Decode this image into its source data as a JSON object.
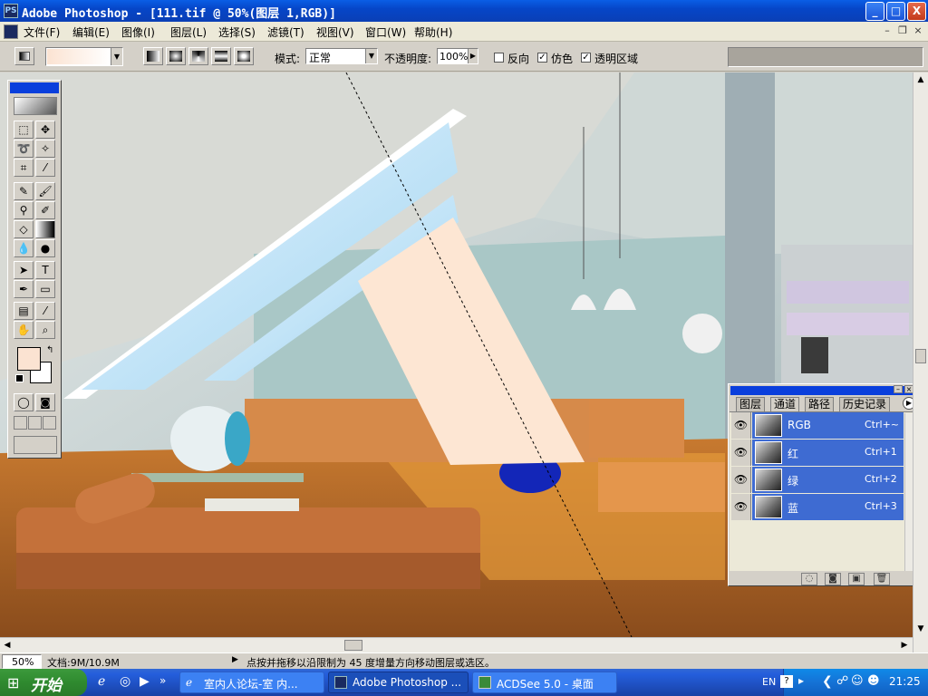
{
  "window": {
    "title": "Adobe Photoshop - [111.tif @ 50%(图层 1,RGB)]",
    "app_icon": "PS",
    "minimize": "_",
    "maximize": "□",
    "close": "X"
  },
  "menu": {
    "items": [
      "文件(F)",
      "编辑(E)",
      "图像(I)",
      "图层(L)",
      "选择(S)",
      "滤镜(T)",
      "视图(V)",
      "窗口(W)",
      "帮助(H)"
    ],
    "doc_minimize": "–",
    "doc_restore": "❐",
    "doc_close": "×"
  },
  "options": {
    "mode_label": "模式:",
    "mode_value": "正常",
    "opacity_label": "不透明度:",
    "opacity_value": "100%",
    "reverse_label": "反向",
    "reverse_checked": false,
    "dither_label": "仿色",
    "dither_checked": true,
    "transparency_label": "透明区域",
    "transparency_checked": true,
    "gradient_color": "#fbe3d2"
  },
  "status": {
    "zoom": "50%",
    "doc_size": "文档:9M/10.9M",
    "hint": "点按并拖移以沿限制为 45 度增量方向移动图层或选区。"
  },
  "palette": {
    "tabs": [
      "图层",
      "通道",
      "路径",
      "历史记录"
    ],
    "active_tab": "通道",
    "channels": [
      {
        "name": "RGB",
        "shortcut": "Ctrl+~"
      },
      {
        "name": "红",
        "shortcut": "Ctrl+1"
      },
      {
        "name": "绿",
        "shortcut": "Ctrl+2"
      },
      {
        "name": "蓝",
        "shortcut": "Ctrl+3"
      }
    ]
  },
  "colors": {
    "foreground": "#fbe3d2",
    "background": "#ffffff",
    "selection": "#3e6bd2"
  },
  "taskbar": {
    "start_label": "开始",
    "buttons": [
      {
        "label": "室内人论坛-室 内..."
      },
      {
        "label": "Adobe Photoshop ..."
      },
      {
        "label": "ACDSee 5.0 - 桌面"
      }
    ],
    "lang": "EN",
    "clock": "21:25"
  }
}
